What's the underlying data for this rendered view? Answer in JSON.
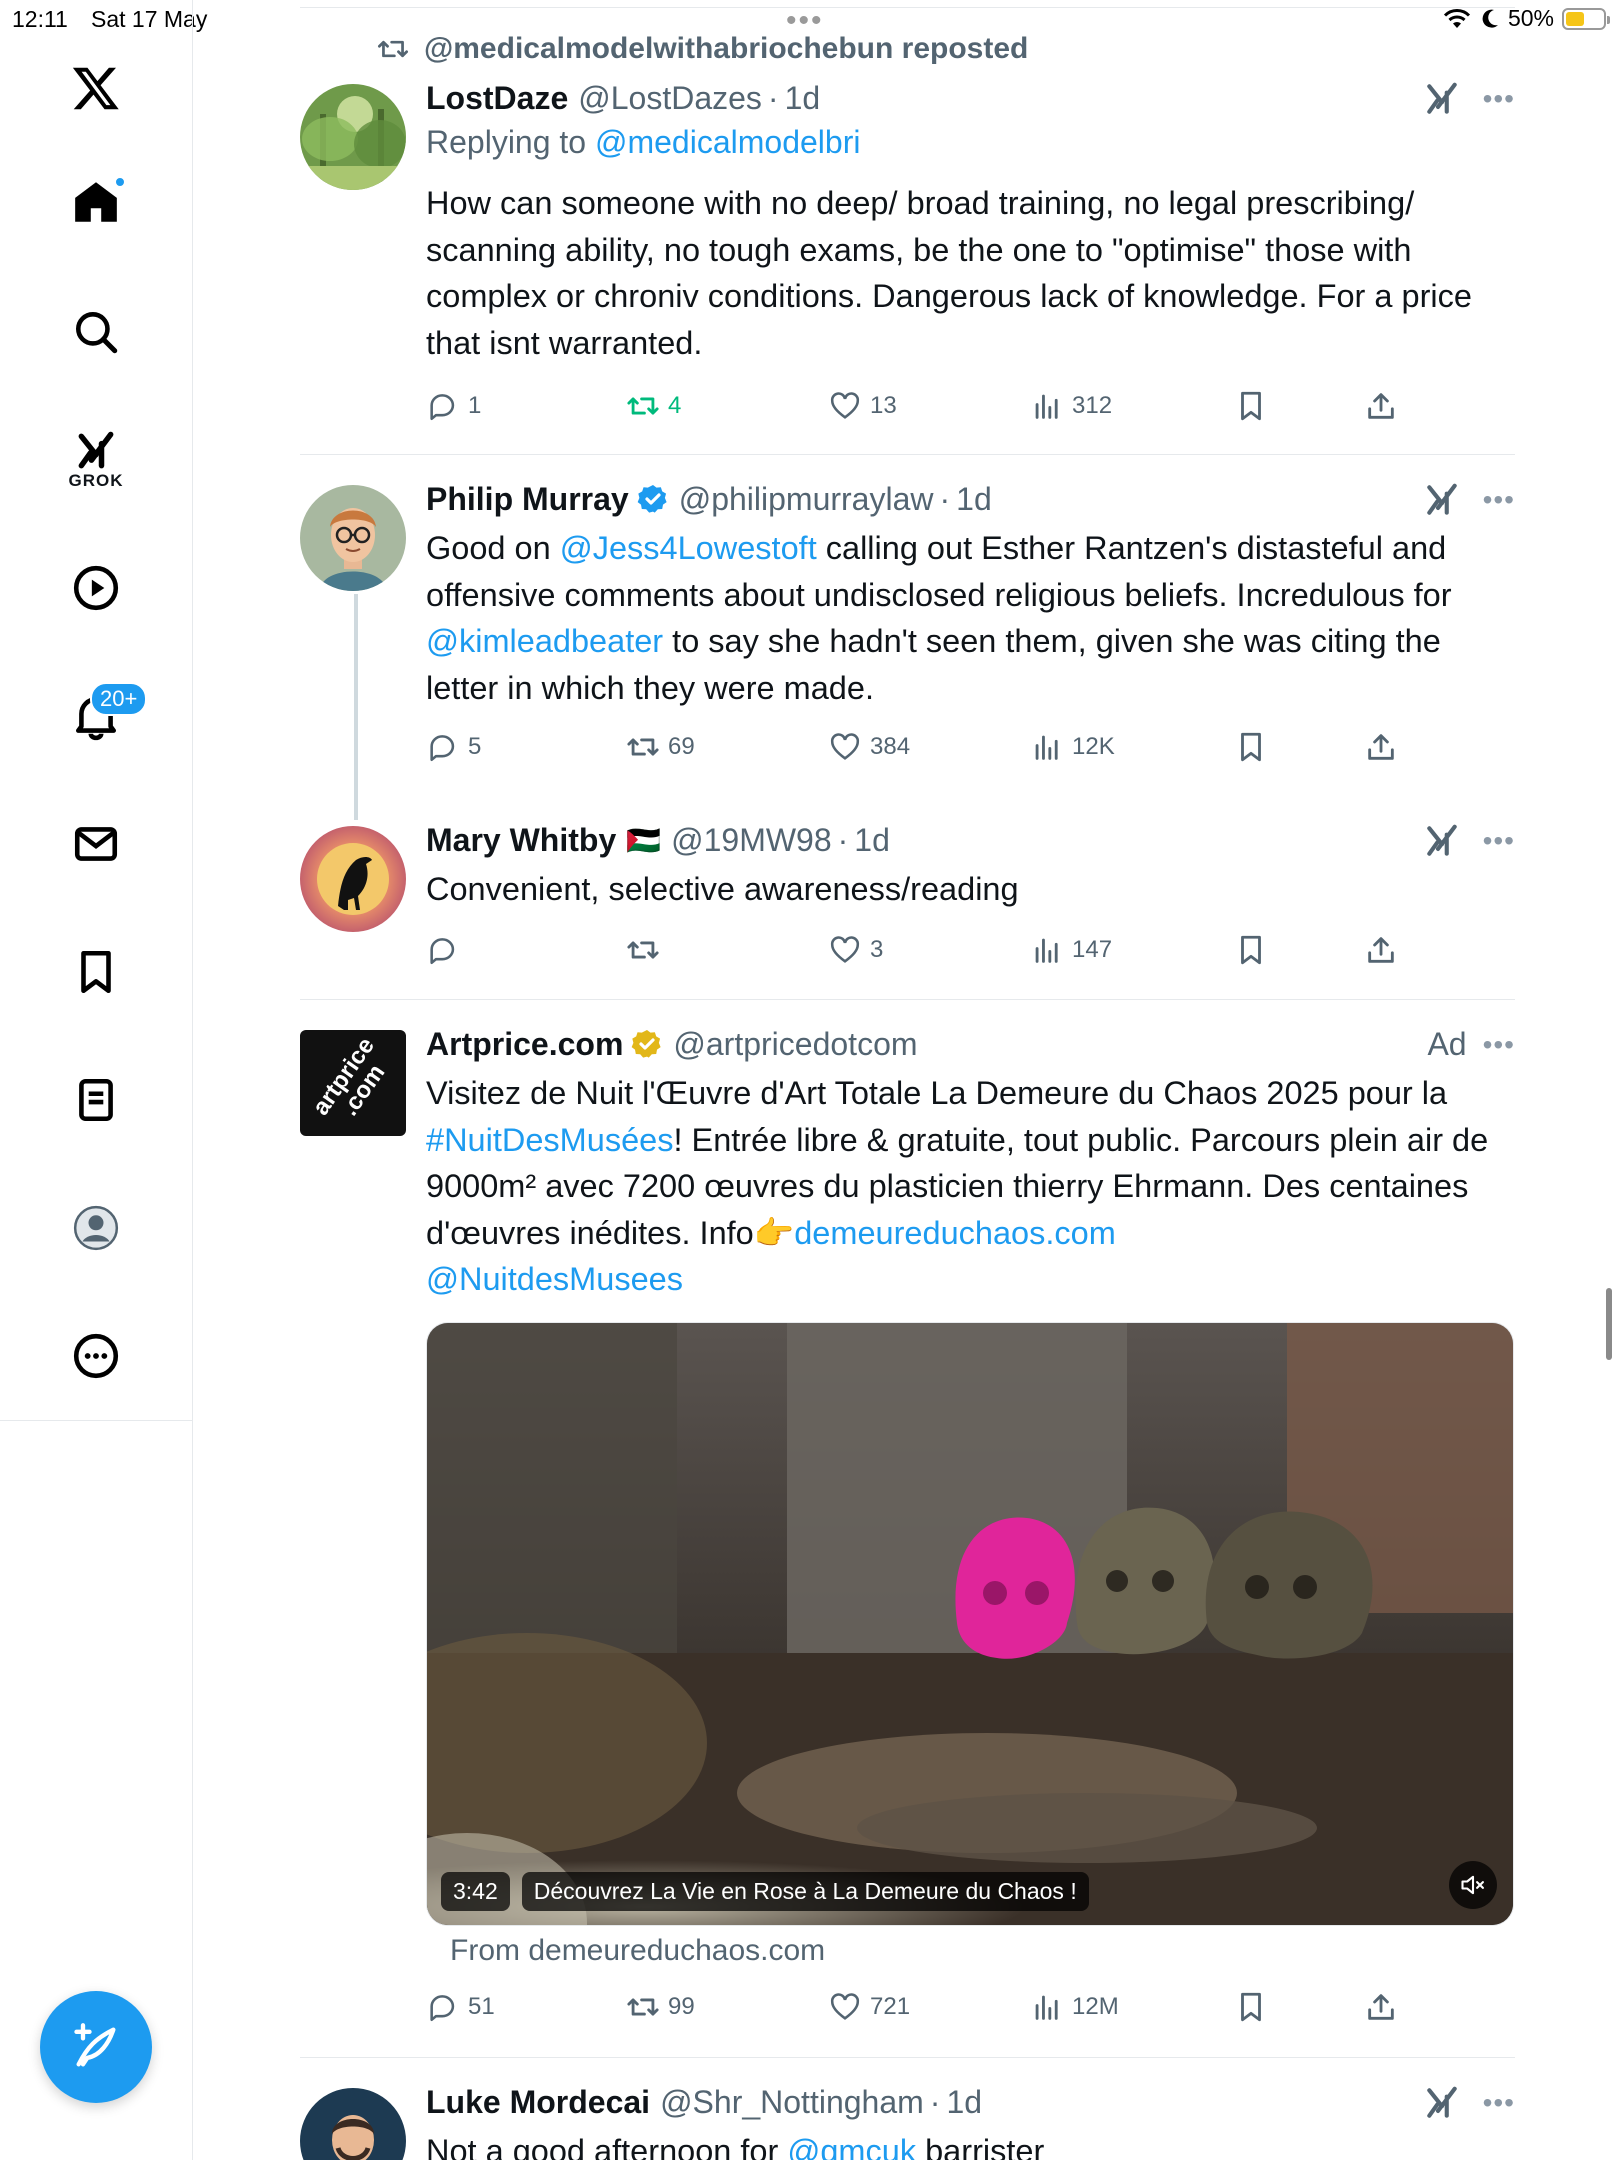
{
  "status_bar": {
    "time": "12:11",
    "date": "Sat 17 May",
    "battery": "50%",
    "battery_level": 0.5
  },
  "sidebar": {
    "grok_label": "GROK",
    "notifications_badge": "20+"
  },
  "repost_banner": "@medicalmodelwithabriochebun reposted",
  "tweets": [
    {
      "name": "LostDaze",
      "handle": "@LostDazes",
      "time": "1d",
      "replying_to_prefix": "Replying to ",
      "replying_to": "@medicalmodelbri",
      "text": "How can someone with no deep/ broad training, no legal prescribing/ scanning ability, no tough exams, be the one to \"optimise\" those with complex or chroniv conditions. Dangerous lack of knowledge. For a price that isnt warranted.",
      "replies": "1",
      "reposts": "4",
      "likes": "13",
      "views": "312"
    },
    {
      "name": "Philip Murray",
      "handle": "@philipmurraylaw",
      "time": "1d",
      "text_parts": [
        "Good on ",
        "@Jess4Lowestoft",
        " calling out Esther Rantzen's distasteful and offensive comments about undisclosed religious beliefs. Incredulous for ",
        "@kimleadbeater",
        " to say she hadn't seen them, given she was citing the letter in which they were made."
      ],
      "replies": "5",
      "reposts": "69",
      "likes": "384",
      "views": "12K"
    },
    {
      "name": "Mary Whitby",
      "flag": "🇵🇸",
      "handle": "@19MW98",
      "time": "1d",
      "text": "Convenient, selective awareness/reading",
      "replies": "",
      "reposts": "",
      "likes": "3",
      "views": "147"
    },
    {
      "name": "Artprice.com",
      "handle": "@artpricedotcom",
      "ad_label": "Ad",
      "text_parts": [
        "Visitez de Nuit l'Œuvre d'Art Totale La Demeure du Chaos 2025 pour la ",
        "#NuitDesMusées",
        "! Entrée libre & gratuite, tout public. Parcours plein air de 9000m² avec 7200 œuvres du plasticien thierry Ehrmann. Des centaines d'œuvres inédites. Info👉",
        "demeureduchaos.com",
        " ",
        "@NuitdesMusees"
      ],
      "video_duration": "3:42",
      "video_title": "Découvrez La Vie en Rose à La Demeure du Chaos !",
      "from_line": "From demeureduchaos.com",
      "replies": "51",
      "reposts": "99",
      "likes": "721",
      "views": "12M"
    },
    {
      "name": "Luke Mordecai",
      "handle": "@Shr_Nottingham",
      "time": "1d",
      "text_parts": [
        "Not a good afternoon for ",
        "@gmcuk",
        " barrister"
      ]
    }
  ],
  "colors": {
    "accent": "#1d9bf0",
    "repost_green": "#00ba7c",
    "muted": "#536471"
  }
}
